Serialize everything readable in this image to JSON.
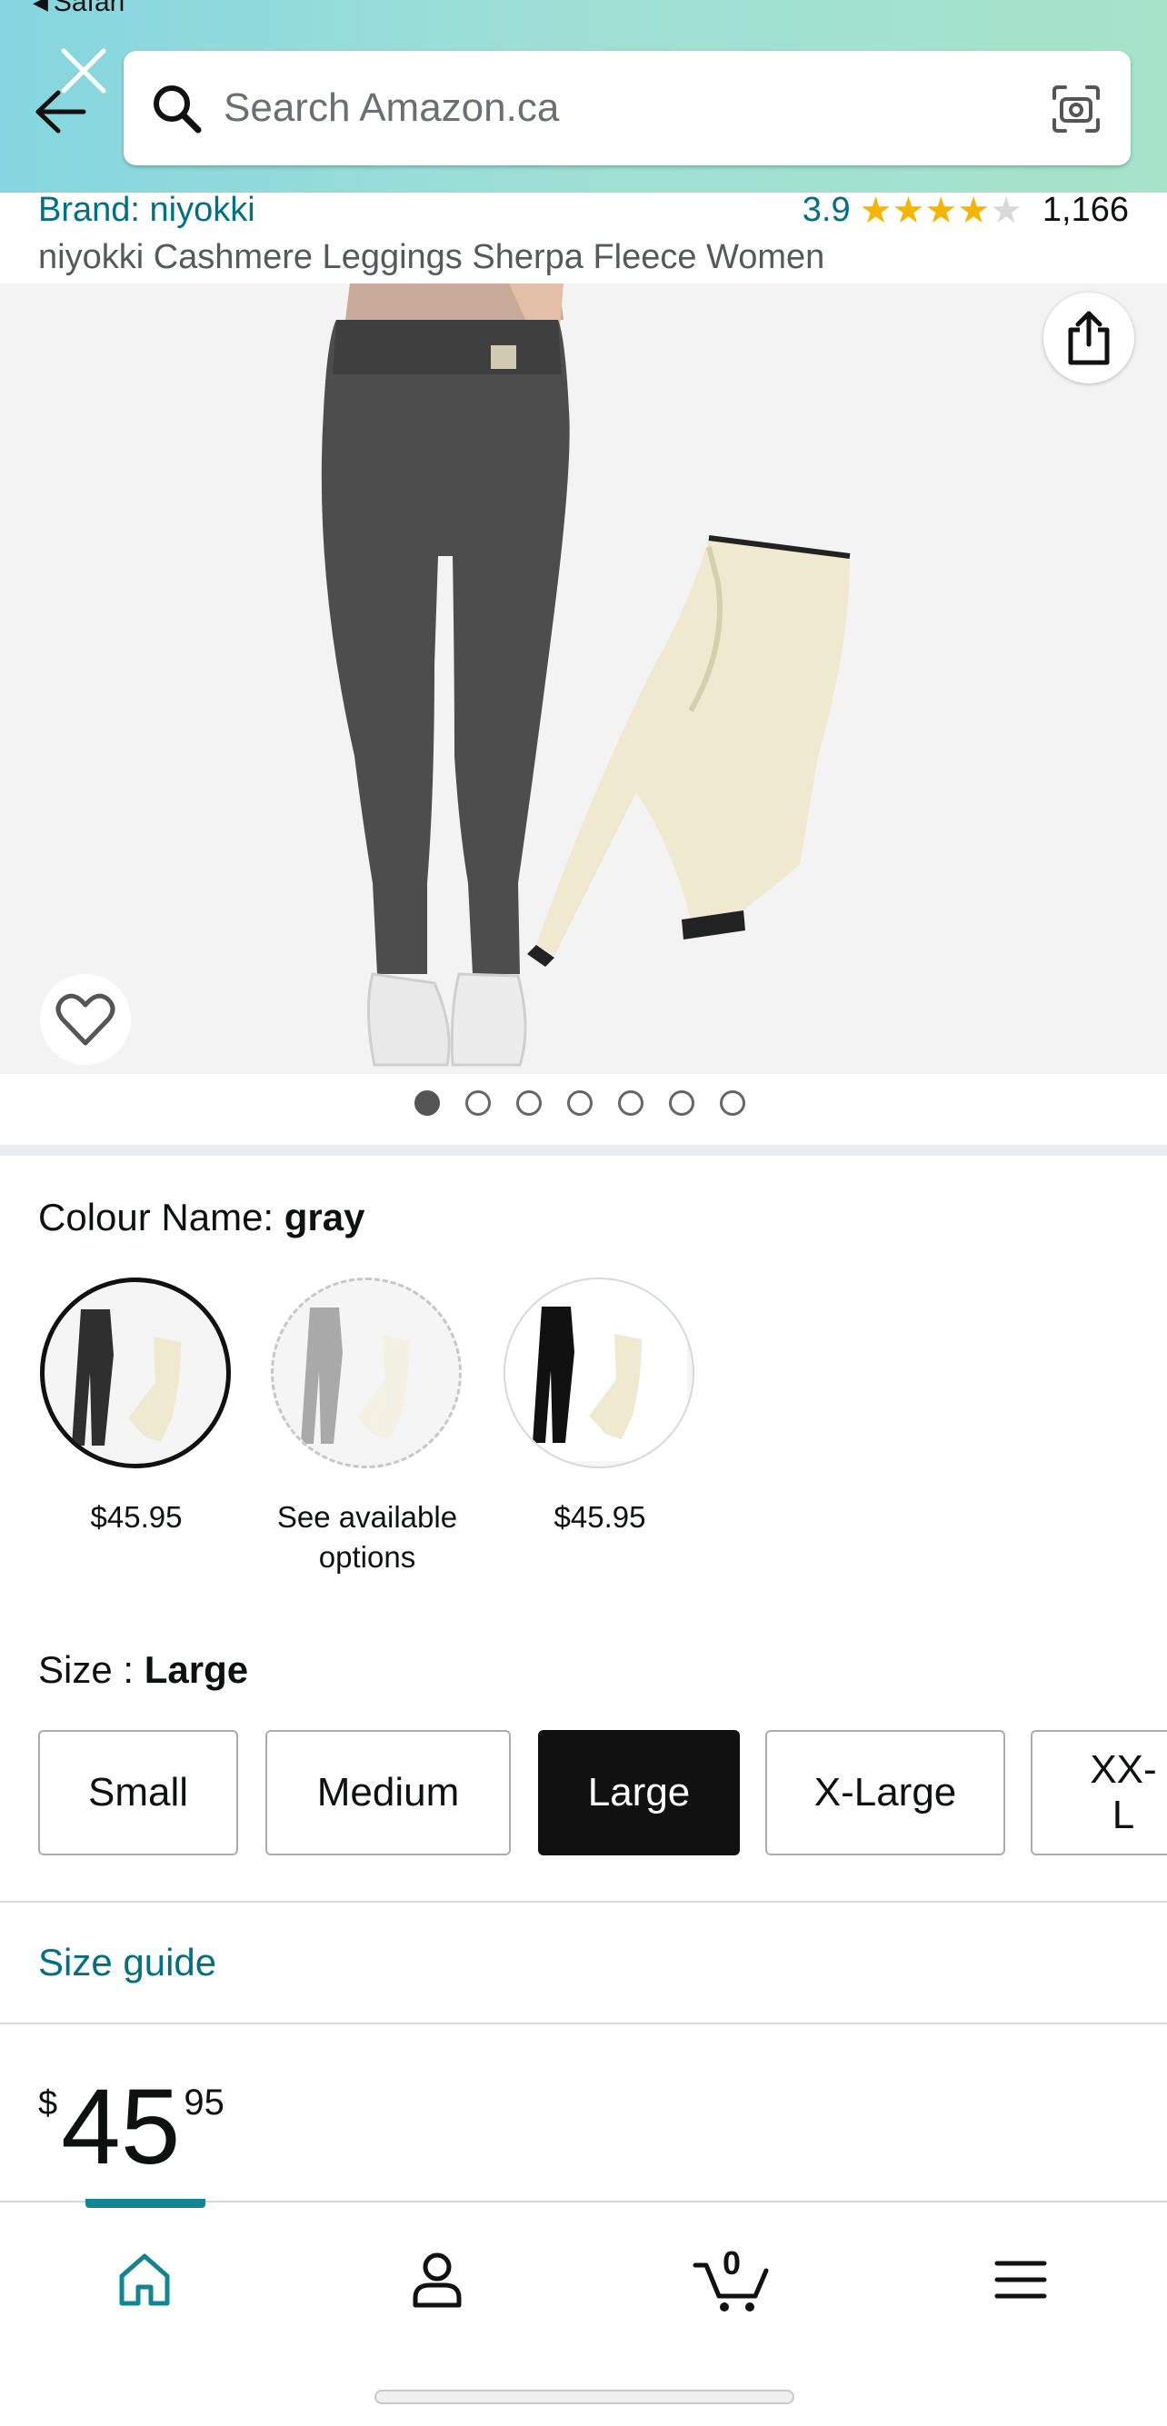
{
  "status_bar": {
    "back_app": "Safari"
  },
  "search": {
    "placeholder": "Search Amazon.ca"
  },
  "product": {
    "brand_link": "Brand: niyokki",
    "rating_value": "3.9",
    "rating_stars": 3.9,
    "rating_count": "1,166",
    "title": "niyokki Cashmere Leggings Sherpa Fleece Women",
    "image_count": 7,
    "image_active_index": 0
  },
  "colour": {
    "label": "Colour Name:",
    "selected": "gray",
    "options": [
      {
        "name": "gray",
        "price": "$45.95",
        "state": "selected"
      },
      {
        "name": "unavailable",
        "price": "See available options",
        "state": "unavailable"
      },
      {
        "name": "black",
        "price": "$45.95",
        "state": "available"
      }
    ]
  },
  "size": {
    "label": "Size :",
    "selected": "Large",
    "options": [
      "Small",
      "Medium",
      "Large",
      "X-Large",
      "XX-L"
    ]
  },
  "size_guide": "Size guide",
  "price": {
    "symbol": "$",
    "whole": "45",
    "fraction": "95"
  },
  "bottom_nav": {
    "cart_count": "0",
    "items": [
      "home-icon",
      "account-icon",
      "cart-icon",
      "menu-icon"
    ],
    "active": "home"
  },
  "colors": {
    "link": "#007185",
    "star": "#f5b400",
    "header_gradient_start": "#85d6e0",
    "header_gradient_end": "#a6e3c9",
    "nav_active": "#138496"
  }
}
